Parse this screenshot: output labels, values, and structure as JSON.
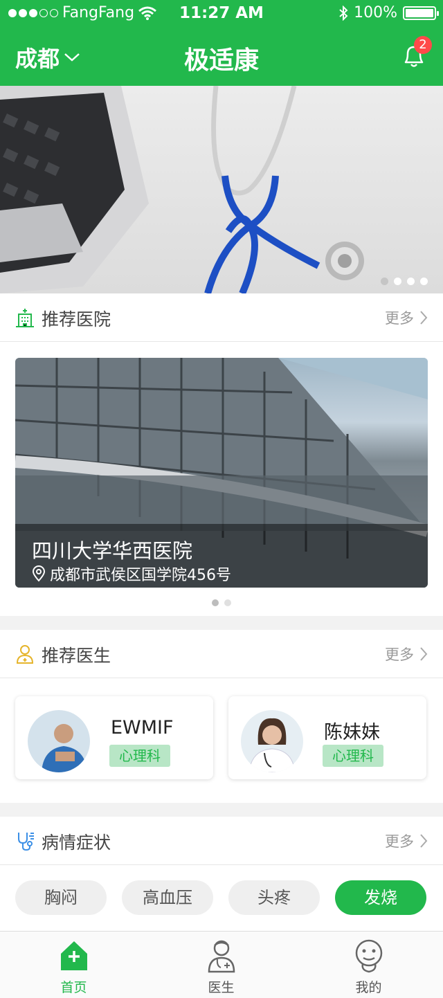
{
  "status_bar": {
    "carrier": "FangFang",
    "time": "11:27 AM",
    "battery": "100%"
  },
  "nav": {
    "city": "成都",
    "title": "极适康",
    "notification_count": "2"
  },
  "colors": {
    "brand": "#22b84c",
    "badge": "#ff4a4a"
  },
  "banner": {
    "page_count": 4,
    "active_page": 1
  },
  "hospitals": {
    "title": "推荐医院",
    "more": "更多",
    "card": {
      "name": "四川大学华西医院",
      "address": "成都市武侯区国学院456号"
    },
    "page_count": 2,
    "active_page": 1
  },
  "doctors": {
    "title": "推荐医生",
    "more": "更多",
    "items": [
      {
        "name": "EWMIF",
        "dept": "心理科"
      },
      {
        "name": "陈妹妹",
        "dept": "心理科"
      }
    ]
  },
  "symptoms": {
    "title": "病情症状",
    "more": "更多",
    "items": [
      {
        "label": "胸闷",
        "selected": false
      },
      {
        "label": "高血压",
        "selected": false
      },
      {
        "label": "头疼",
        "selected": false
      },
      {
        "label": "发烧",
        "selected": true
      }
    ]
  },
  "tabbar": {
    "items": [
      {
        "label": "首页",
        "icon": "home-icon",
        "active": true
      },
      {
        "label": "医生",
        "icon": "doctor-icon",
        "active": false
      },
      {
        "label": "我的",
        "icon": "profile-icon",
        "active": false
      }
    ]
  }
}
